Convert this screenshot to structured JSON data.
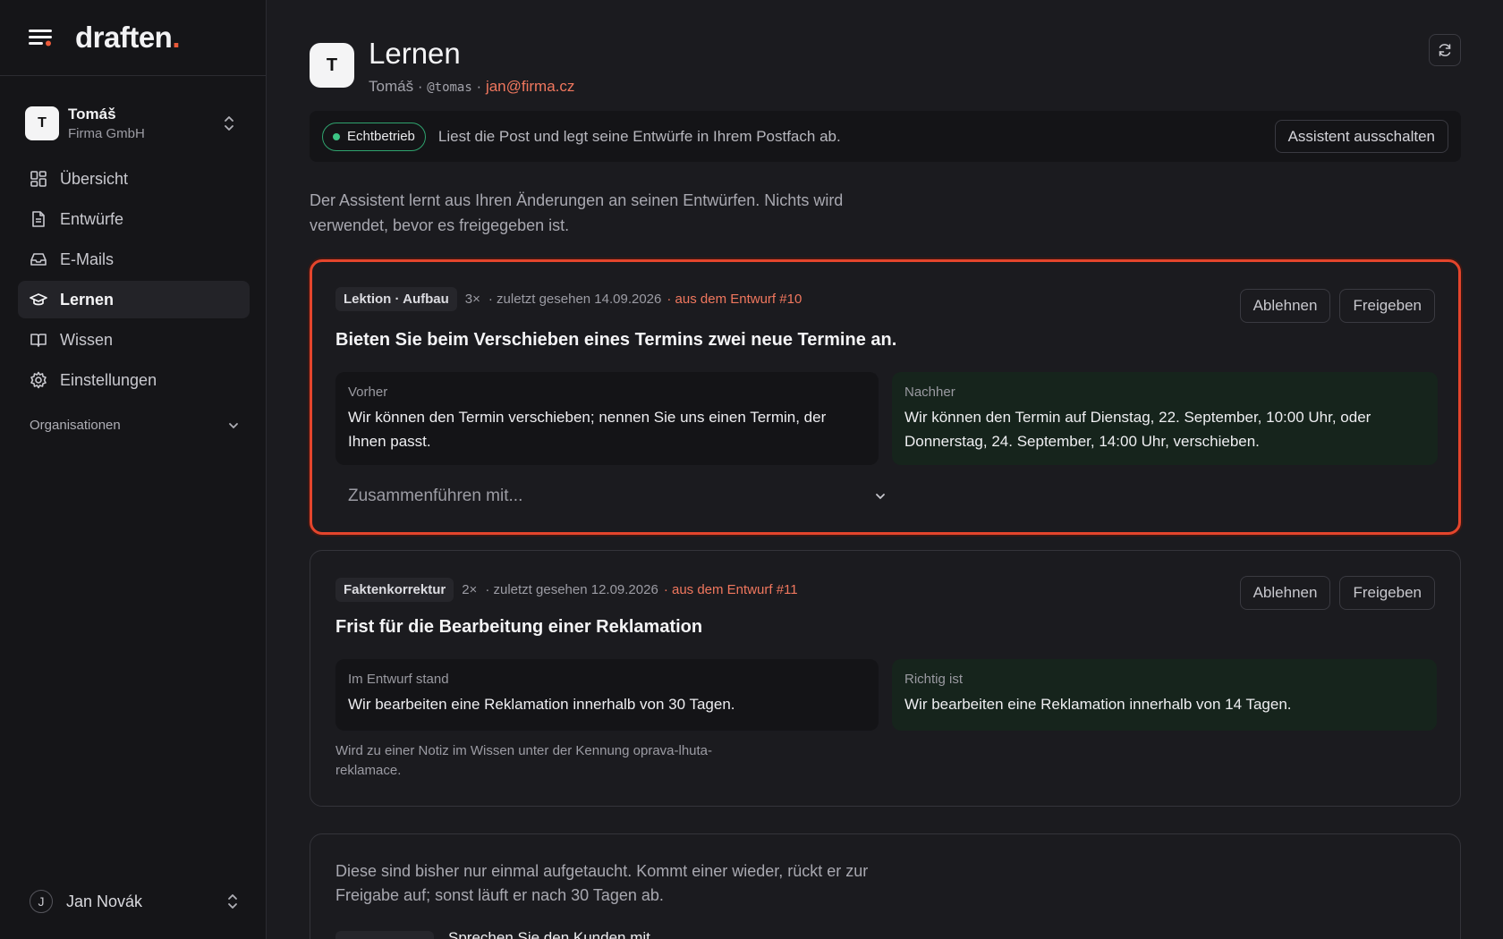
{
  "brand": {
    "name": "draften",
    "dot": "."
  },
  "workspace": {
    "initial": "T",
    "name": "Tomáš",
    "org": "Firma GmbH"
  },
  "nav": [
    {
      "label": "Übersicht",
      "icon": "grid-icon"
    },
    {
      "label": "Entwürfe",
      "icon": "document-icon"
    },
    {
      "label": "E-Mails",
      "icon": "inbox-icon"
    },
    {
      "label": "Lernen",
      "icon": "graduation-cap-icon",
      "active": true
    },
    {
      "label": "Wissen",
      "icon": "book-icon"
    },
    {
      "label": "Einstellungen",
      "icon": "gear-icon"
    }
  ],
  "org_section": {
    "label": "Organisationen"
  },
  "user": {
    "initial": "J",
    "name": "Jan Novák"
  },
  "page": {
    "initial": "T",
    "title": "Lernen",
    "user_name": "Tomáš",
    "separator": "·",
    "handle": "@tomas",
    "email": "jan@firma.cz"
  },
  "status": {
    "badge": "Echtbetrieb",
    "text": "Liest die Post und legt seine Entwürfe in Ihrem Postfach ab.",
    "button": "Assistent ausschalten"
  },
  "intro": "Der Assistent lernt aus Ihren Änderungen an seinen Entwürfen. Nichts wird verwendet, bevor es freigegeben ist.",
  "cards": [
    {
      "tag": "Lektion · Aufbau",
      "count": "3×",
      "seen": "· zuletzt gesehen 14.09.2026",
      "source": "· aus dem Entwurf #10",
      "reject": "Ablehnen",
      "approve": "Freigeben",
      "title": "Bieten Sie beim Verschieben eines Termins zwei neue Termine an.",
      "before_label": "Vorher",
      "before_text": "Wir können den Termin verschieben; nennen Sie uns einen Termin, der Ihnen passt.",
      "after_label": "Nachher",
      "after_text": "Wir können den Termin auf Dienstag, 22. September, 10:00 Uhr, oder Donnerstag, 24. September, 14:00 Uhr, verschieben.",
      "merge_placeholder": "Zusammenführen mit..."
    },
    {
      "tag": "Faktenkorrektur",
      "count": "2×",
      "seen": "· zuletzt gesehen 12.09.2026",
      "source": "· aus dem Entwurf #11",
      "reject": "Ablehnen",
      "approve": "Freigeben",
      "title": "Frist für die Bearbeitung einer Reklamation",
      "before_label": "Im Entwurf stand",
      "before_text": "Wir bearbeiten eine Reklamation innerhalb von 30 Tagen.",
      "after_label": "Richtig ist",
      "after_text": "Wir bearbeiten eine Reklamation innerhalb von 14 Tagen.",
      "note": "Wird zu einer Notiz im Wissen unter der Kennung oprava-lhuta-reklamace."
    }
  ],
  "pending": {
    "text": "Diese sind bisher nur einmal aufgetaucht. Kommt einer wieder, rückt er zur Freigabe auf; sonst läuft er nach 30 Tagen ab.",
    "partial_item": "Sprechen Sie den Kunden mit"
  },
  "colors": {
    "accent": "#ea5a3a",
    "live": "#3cc585",
    "highlight": "#e4452c"
  }
}
